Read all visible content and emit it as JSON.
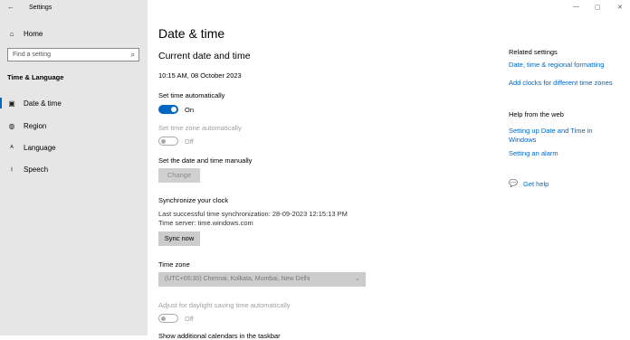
{
  "window": {
    "title": "Settings",
    "back_icon": "back-arrow-icon",
    "minimize": "—",
    "maximize": "▢",
    "close": "✕"
  },
  "sidebar": {
    "home_label": "Home",
    "search_placeholder": "Find a setting",
    "category": "Time & Language",
    "items": [
      {
        "label": "Date & time",
        "icon": "calendar-clock-icon",
        "active": true
      },
      {
        "label": "Region",
        "icon": "globe-icon",
        "active": false
      },
      {
        "label": "Language",
        "icon": "language-icon",
        "active": false
      },
      {
        "label": "Speech",
        "icon": "microphone-icon",
        "active": false
      }
    ]
  },
  "main": {
    "page_title": "Date & time",
    "section_title": "Current date and time",
    "current_datetime": "10:15 AM, 08 October 2023",
    "set_time_auto": {
      "label": "Set time automatically",
      "state": "On",
      "enabled": true,
      "on": true
    },
    "set_timezone_auto": {
      "label": "Set time zone automatically",
      "state": "Off",
      "enabled": false,
      "on": false
    },
    "manual": {
      "label": "Set the date and time manually",
      "button": "Change"
    },
    "sync": {
      "title": "Synchronize your clock",
      "last_sync": "Last successful time synchronization: 28-09-2023 12:15:13 PM",
      "server": "Time server: time.windows.com",
      "button": "Sync now"
    },
    "timezone": {
      "label": "Time zone",
      "value": "(UTC+05:30) Chennai, Kolkata, Mumbai, New Delhi"
    },
    "dst": {
      "label": "Adjust for daylight saving time automatically",
      "state": "Off",
      "enabled": false,
      "on": false
    },
    "cutoff_text": "Show additional calendars in the taskbar"
  },
  "related": {
    "title": "Related settings",
    "links": [
      "Date, time & regional formatting",
      "Add clocks for different time zones"
    ]
  },
  "help": {
    "title": "Help from the web",
    "links": [
      "Setting up Date and Time in",
      "Windows",
      "Setting an alarm"
    ],
    "get_help": "Get help"
  },
  "colors": {
    "accent": "#0067c0",
    "sidebar_bg": "#e6e6e6"
  }
}
